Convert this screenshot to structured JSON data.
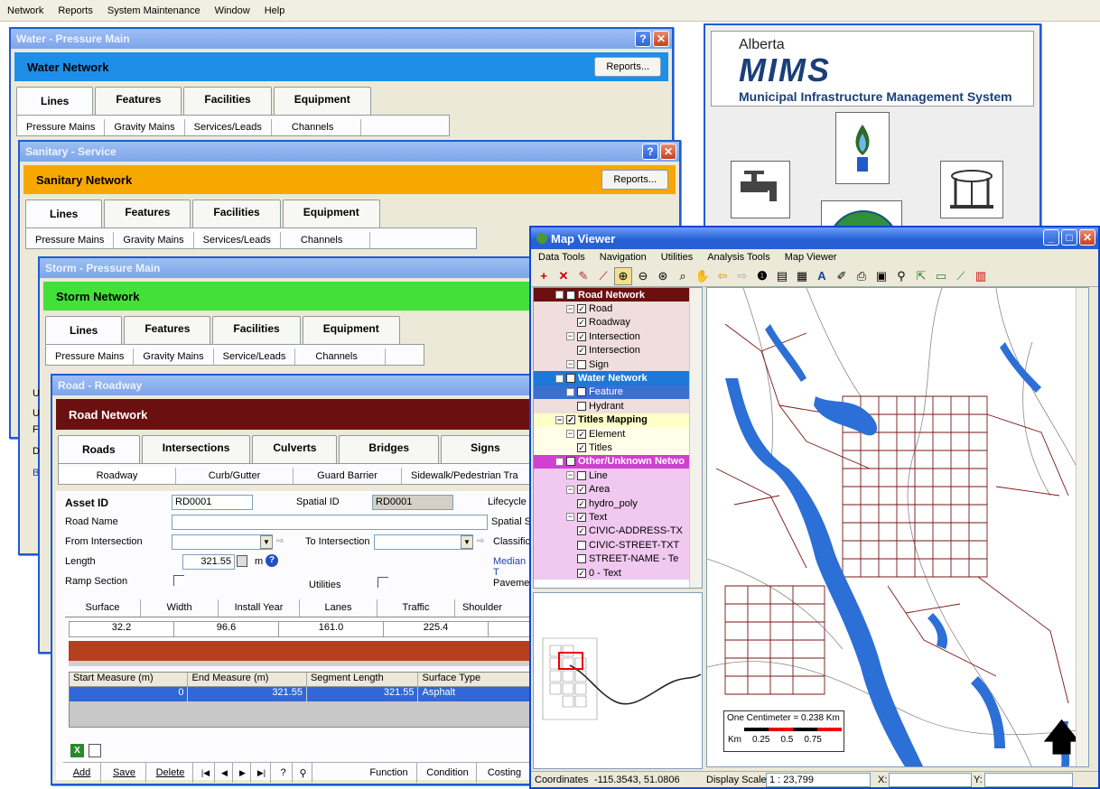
{
  "menubar": [
    "Network",
    "Reports",
    "System Maintenance",
    "Window",
    "Help"
  ],
  "water_window": {
    "title": "Water - Pressure Main",
    "banner": "Water Network",
    "reports": "Reports...",
    "tabs": [
      "Lines",
      "Features",
      "Facilities",
      "Equipment"
    ],
    "subtabs": [
      "Pressure Mains",
      "Gravity Mains",
      "Services/Leads",
      "Channels"
    ]
  },
  "sanitary_window": {
    "title": "Sanitary - Service",
    "banner": "Sanitary Network",
    "reports": "Reports...",
    "tabs": [
      "Lines",
      "Features",
      "Facilities",
      "Equipment"
    ],
    "subtabs": [
      "Pressure Mains",
      "Gravity Mains",
      "Services/Leads",
      "Channels"
    ]
  },
  "storm_window": {
    "title": "Storm - Pressure Main",
    "banner": "Storm Network",
    "tabs": [
      "Lines",
      "Features",
      "Facilities",
      "Equipment"
    ],
    "subtabs": [
      "Pressure Mains",
      "Gravity Mains",
      "Service/Leads",
      "Channels"
    ]
  },
  "road_window": {
    "title": "Road - Roadway",
    "banner": "Road Network",
    "tabs": [
      "Roads",
      "Intersections",
      "Culverts",
      "Bridges",
      "Signs"
    ],
    "subtabs": [
      "Roadway",
      "Curb/Gutter",
      "Guard Barrier",
      "Sidewalk/Pedestrian Tra"
    ],
    "asset_id_label": "Asset ID",
    "asset_id": "RD0001",
    "spatial_id_label": "Spatial ID",
    "spatial_id": "RD0001",
    "lifecycle_label": "Lifecycle",
    "spatial_s_label": "Spatial S",
    "road_name_label": "Road Name",
    "from_intersection_label": "From Intersection",
    "to_intersection_label": "To Intersection",
    "classification_label": "Classifica",
    "length_label": "Length",
    "length_value": "321.55",
    "length_unit": "m",
    "median_label": "Median T",
    "ramp_label": "Ramp Section",
    "utilities_label": "Utilities",
    "pavement_label": "Pavemen",
    "segment_tabs": [
      "Surface",
      "Width",
      "Install Year",
      "Lanes",
      "Traffic",
      "Shoulder"
    ],
    "scale_ticks": [
      "32.2",
      "96.6",
      "161.0",
      "225.4"
    ],
    "grid_headers": [
      "Start Measure (m)",
      "End Measure (m)",
      "Segment Length",
      "Surface Type"
    ],
    "grid_row": [
      "0",
      "321.55",
      "321.55",
      "Asphalt"
    ],
    "buttons": [
      "Add",
      "Save",
      "Delete",
      "Function",
      "Condition",
      "Costing"
    ]
  },
  "side_labels": [
    "U",
    "U",
    "F",
    "D",
    "B"
  ],
  "mims_panel": {
    "province": "Alberta",
    "logo": "MIMS",
    "subtitle": "Municipal Infrastructure Management System"
  },
  "map_viewer": {
    "title": "Map Viewer",
    "menu": [
      "Data Tools",
      "Navigation",
      "Utilities",
      "Analysis Tools",
      "Map Viewer"
    ],
    "layers": [
      {
        "label": "Road Network",
        "level": 0,
        "checked": true,
        "group": true,
        "bg": "#6b0f0f",
        "fg": "#ffffff"
      },
      {
        "label": "Road",
        "level": 1,
        "checked": true,
        "bg": "#f0dede"
      },
      {
        "label": "Roadway",
        "level": 2,
        "checked": true,
        "bg": "#f0dede"
      },
      {
        "label": "Intersection",
        "level": 1,
        "checked": true,
        "bg": "#f0dede"
      },
      {
        "label": "Intersection",
        "level": 2,
        "checked": true,
        "bg": "#f0dede"
      },
      {
        "label": "Sign",
        "level": 1,
        "checked": false,
        "bg": "#f0dede"
      },
      {
        "label": "Water Network",
        "level": 0,
        "checked": false,
        "group": true,
        "bg": "#1e78d8",
        "fg": "#ffffff"
      },
      {
        "label": "Feature",
        "level": 1,
        "checked": false,
        "bg": "#3b6fd0",
        "fg": "#ffffff"
      },
      {
        "label": "Hydrant",
        "level": 2,
        "checked": false,
        "bg": "#f0dede"
      },
      {
        "label": "Titles Mapping",
        "level": 0,
        "checked": true,
        "group": true,
        "bg": "#ffffc8"
      },
      {
        "label": "Element",
        "level": 1,
        "checked": true,
        "bg": "#ffffe8"
      },
      {
        "label": "Titles",
        "level": 2,
        "checked": true,
        "bg": "#ffffe8"
      },
      {
        "label": "Other/Unknown Netwo",
        "level": 0,
        "checked": true,
        "group": true,
        "bg": "#d040d0",
        "fg": "#ffffff"
      },
      {
        "label": "Line",
        "level": 1,
        "checked": false,
        "bg": "#f0c8f0"
      },
      {
        "label": "Area",
        "level": 1,
        "checked": true,
        "bg": "#f0c8f0"
      },
      {
        "label": "hydro_poly",
        "level": 2,
        "checked": true,
        "bg": "#f0c8f0"
      },
      {
        "label": "Text",
        "level": 1,
        "checked": true,
        "bg": "#f0c8f0"
      },
      {
        "label": "CIVIC-ADDRESS-TX",
        "level": 2,
        "checked": true,
        "bg": "#f0c8f0"
      },
      {
        "label": "CIVIC-STREET-TXT",
        "level": 2,
        "checked": false,
        "bg": "#f0c8f0"
      },
      {
        "label": "STREET-NAME - Te",
        "level": 2,
        "checked": false,
        "bg": "#f0c8f0"
      },
      {
        "label": "0 - Text",
        "level": 2,
        "checked": true,
        "bg": "#f0c8f0"
      }
    ],
    "scale_bar_title": "One Centimeter = 0.238 Km",
    "scale_bar_labels": [
      "Km",
      "0.25",
      "0.5",
      "0.75"
    ],
    "coordinates_label": "Coordinates",
    "coordinates": "-115.3543, 51.0806",
    "display_scale_label": "Display Scale",
    "display_scale": "1 : 23,799",
    "x_label": "X:",
    "y_label": "Y:"
  }
}
